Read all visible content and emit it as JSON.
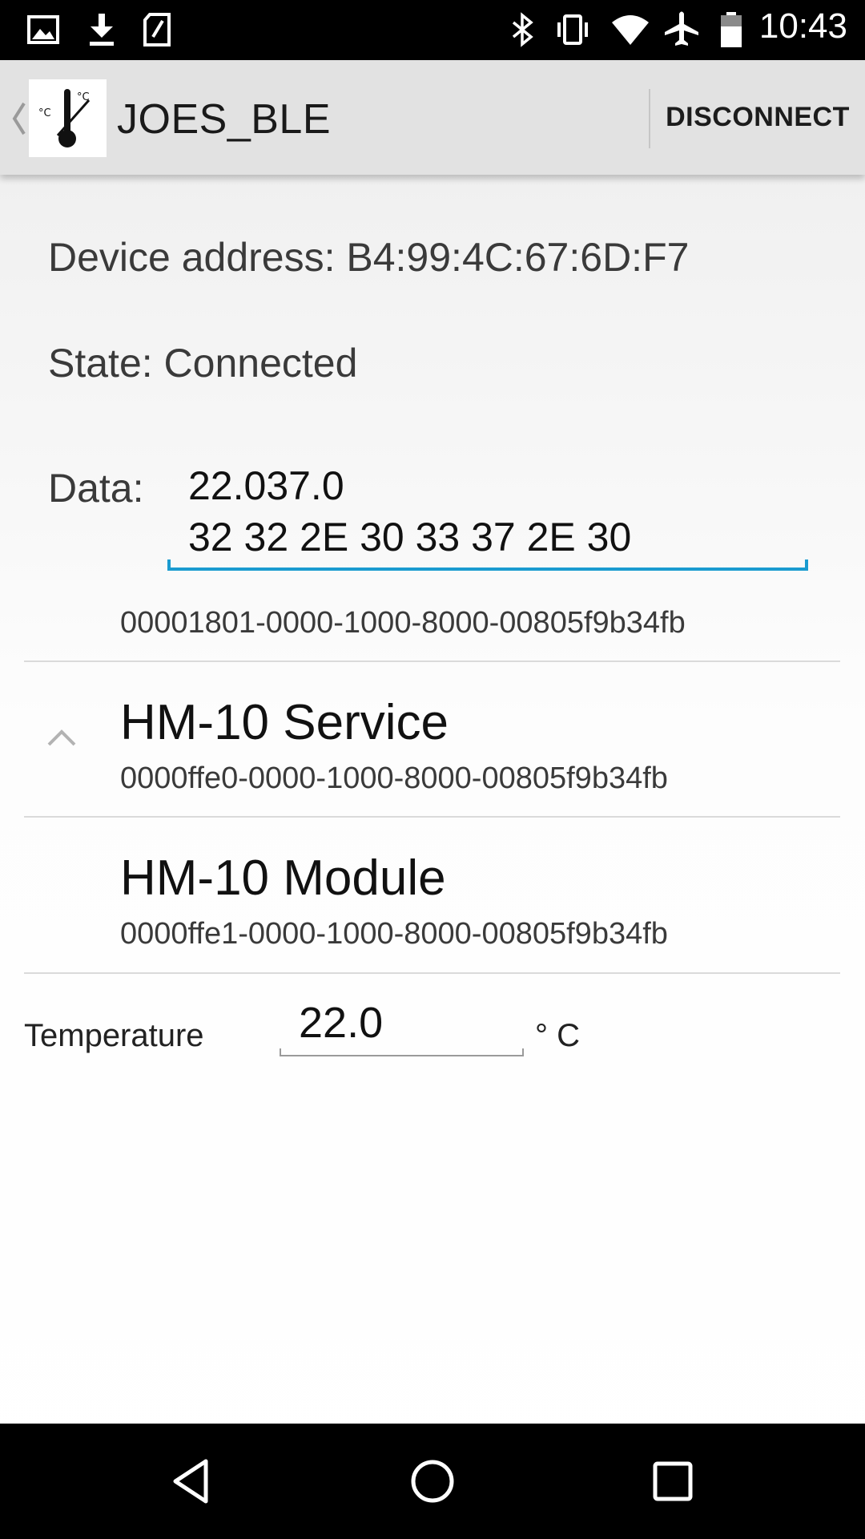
{
  "status_bar": {
    "time": "10:43",
    "icons_left": [
      "image-icon",
      "download-icon",
      "sd-card-icon"
    ],
    "icons_right": [
      "bluetooth-icon",
      "vibrate-icon",
      "wifi-icon",
      "airplane-icon",
      "battery-icon"
    ]
  },
  "action_bar": {
    "title": "JOES_BLE",
    "disconnect_label": "DISCONNECT",
    "app_icon": "thermometer-icon",
    "app_icon_units": [
      "°C",
      "°C"
    ]
  },
  "device": {
    "address": "Device address: B4:99:4C:67:6D:F7",
    "state": "State: Connected",
    "data_label": "Data:",
    "data_line1": "22.037.0",
    "data_line2": "32 32 2E 30 33 37 2E 30"
  },
  "services": [
    {
      "uuid": "00001801-0000-1000-8000-00805f9b34fb"
    },
    {
      "title": "HM-10 Service",
      "uuid": "0000ffe0-0000-1000-8000-00805f9b34fb"
    },
    {
      "title": "HM-10 Module",
      "uuid": "0000ffe1-0000-1000-8000-00805f9b34fb"
    }
  ],
  "temperature": {
    "label": "Temperature",
    "value": "22.0",
    "unit": "° C"
  },
  "nav_bar": {
    "buttons": [
      "back-icon",
      "home-icon",
      "recents-icon"
    ]
  },
  "colors": {
    "accent": "#1a9bd0",
    "action_bar": "#e2e2e2"
  }
}
